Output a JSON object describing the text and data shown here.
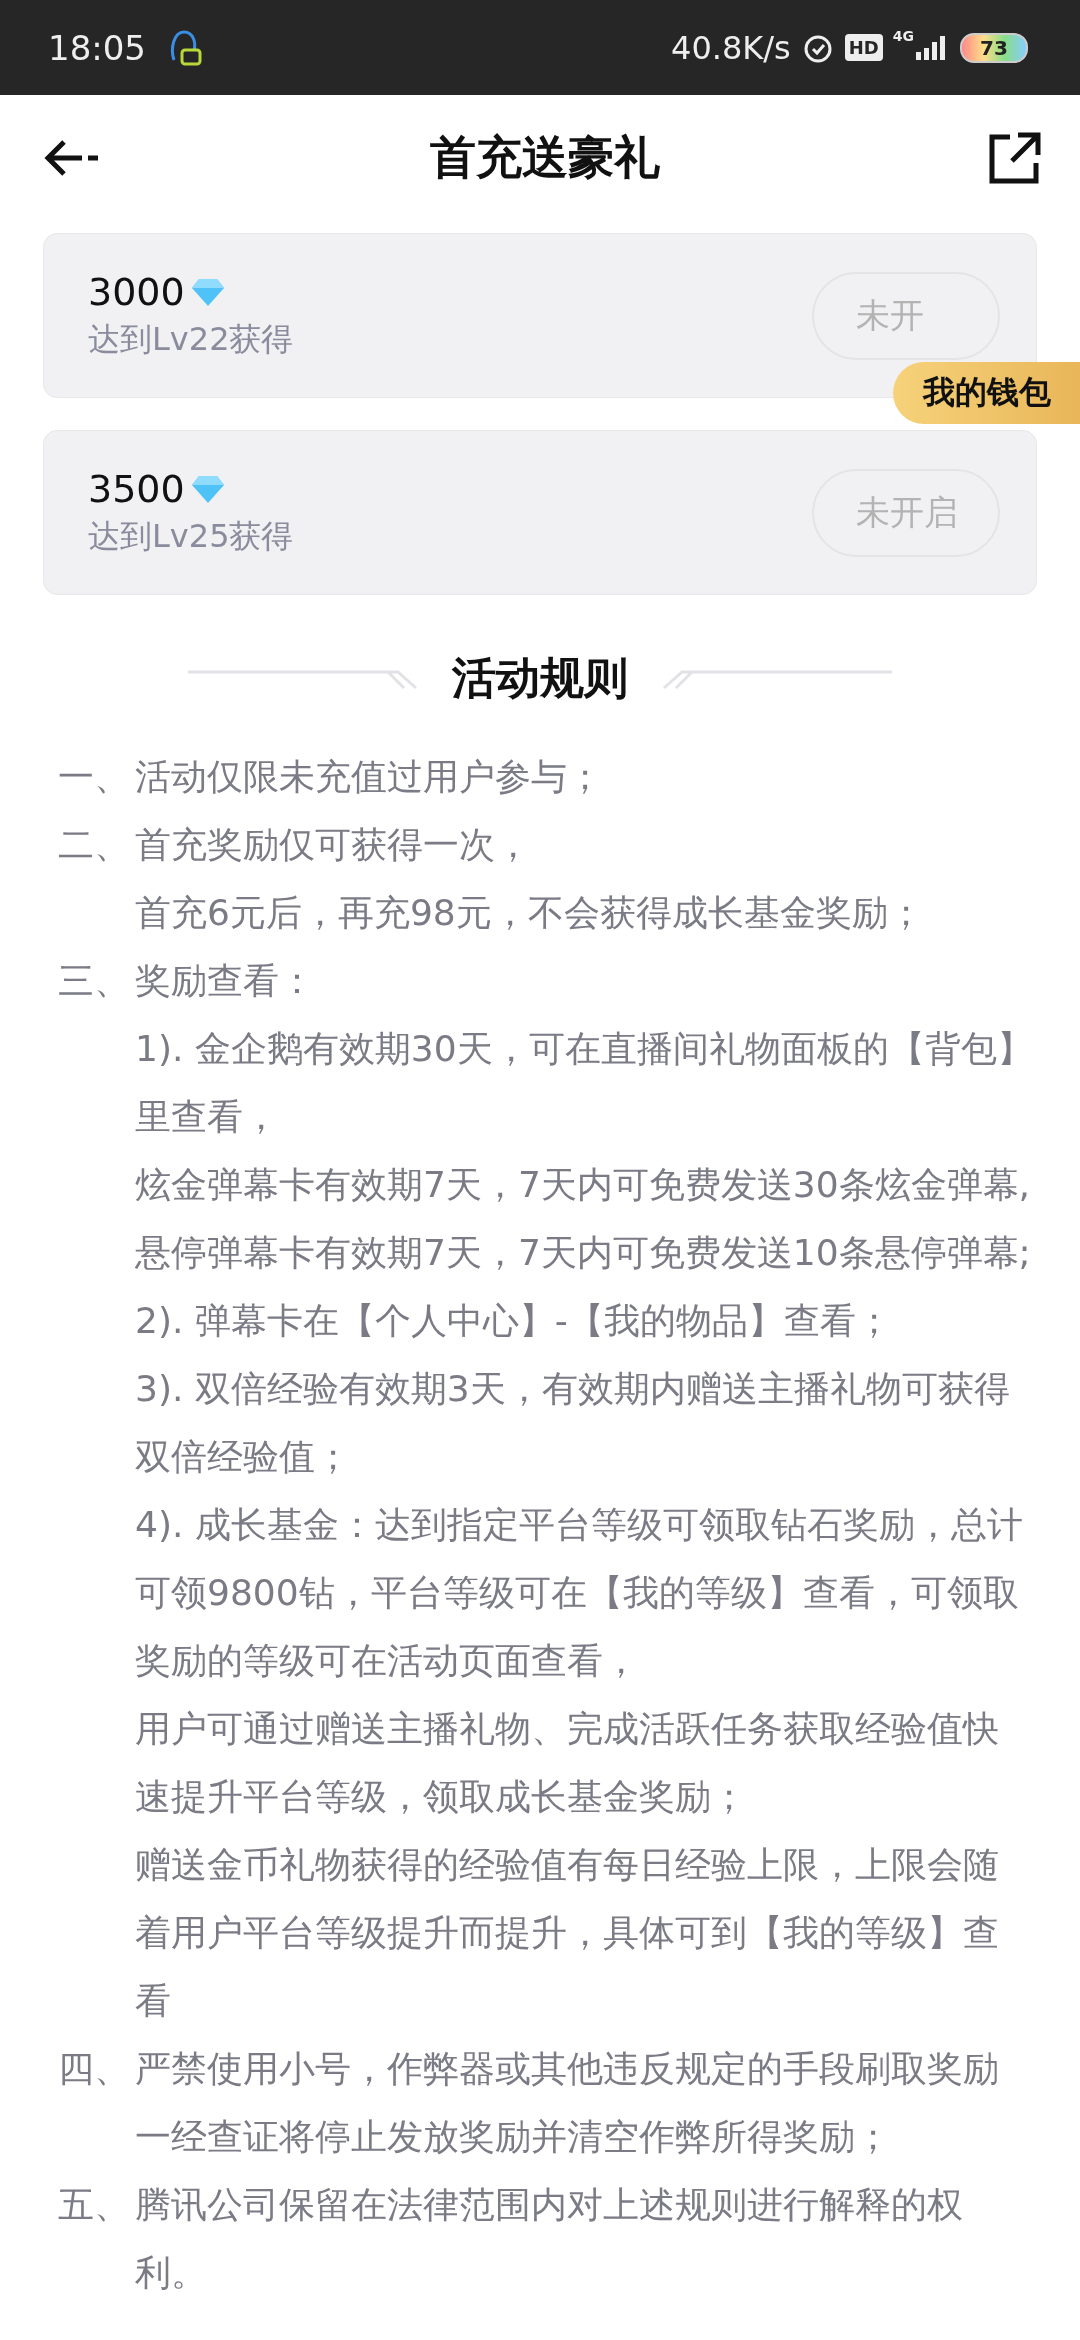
{
  "status_bar": {
    "time": "18:05",
    "speed": "40.8K/s",
    "hd": "HD",
    "network": "4G",
    "battery": "73"
  },
  "header": {
    "title": "首充送豪礼"
  },
  "rewards": [
    {
      "amount": "3000",
      "condition": "达到Lv22获得",
      "button": "未开",
      "disabled": true
    },
    {
      "amount": "3500",
      "condition": "达到Lv25获得",
      "button": "未开启",
      "disabled": true
    }
  ],
  "wallet_badge": "我的钱包",
  "rules": {
    "title": "活动规则",
    "items": [
      {
        "number": "一、",
        "lines": [
          "活动仅限未充值过用户参与；"
        ]
      },
      {
        "number": "二、",
        "lines": [
          "首充奖励仅可获得一次，",
          "首充6元后，再充98元，不会获得成长基金奖励；"
        ]
      },
      {
        "number": "三、",
        "lines": [
          "奖励查看：",
          "1). 金企鹅有效期30天，可在直播间礼物面板的【背包】",
          "里查看，",
          "炫金弹幕卡有效期7天，7天内可免费发送30条炫金弹幕,",
          "悬停弹幕卡有效期7天，7天内可免费发送10条悬停弹幕;",
          "2). 弹幕卡在【个人中心】-【我的物品】查看；",
          "3). 双倍经验有效期3天，有效期内赠送主播礼物可获得",
          "双倍经验值；",
          "4). 成长基金：达到指定平台等级可领取钻石奖励，总计",
          "可领9800钻，平台等级可在【我的等级】查看，可领取",
          "奖励的等级可在活动页面查看，",
          "用户可通过赠送主播礼物、完成活跃任务获取经验值快",
          "速提升平台等级，领取成长基金奖励；",
          "赠送金币礼物获得的经验值有每日经验上限，上限会随",
          "着用户平台等级提升而提升，具体可到【我的等级】查",
          "看"
        ]
      },
      {
        "number": "四、",
        "lines": [
          "严禁使用小号，作弊器或其他违反规定的手段刷取奖励",
          "一经查证将停止发放奖励并清空作弊所得奖励；"
        ]
      },
      {
        "number": "五、",
        "lines": [
          "腾讯公司保留在法律范围内对上述规则进行解释的权",
          "利。"
        ]
      }
    ]
  }
}
